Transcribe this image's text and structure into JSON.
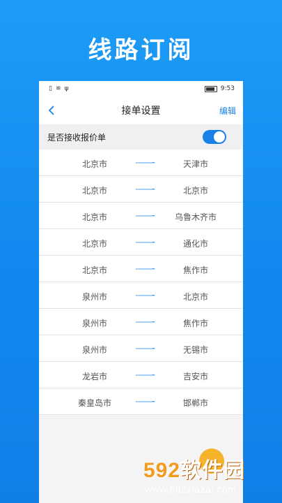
{
  "headline": "线路订阅",
  "status_bar": {
    "time": "9:53"
  },
  "nav": {
    "title": "接单设置",
    "edit_label": "编辑"
  },
  "toggle": {
    "label": "是否接收报价单",
    "on": true
  },
  "routes": [
    {
      "from": "北京市",
      "to": "天津市"
    },
    {
      "from": "北京市",
      "to": "北京市"
    },
    {
      "from": "北京市",
      "to": "乌鲁木齐市"
    },
    {
      "from": "北京市",
      "to": "通化市"
    },
    {
      "from": "北京市",
      "to": "焦作市"
    },
    {
      "from": "泉州市",
      "to": "北京市"
    },
    {
      "from": "泉州市",
      "to": "焦作市"
    },
    {
      "from": "泉州市",
      "to": "无锡市"
    },
    {
      "from": "龙岩市",
      "to": "吉安市"
    },
    {
      "from": "秦皇岛市",
      "to": "邯郸市"
    }
  ],
  "watermark": {
    "logo_num": "592",
    "logo_cn": "软件园",
    "url": "www.592xiazai.com"
  },
  "colors": {
    "accent": "#1a82e6",
    "background": "#1e9bf6"
  }
}
